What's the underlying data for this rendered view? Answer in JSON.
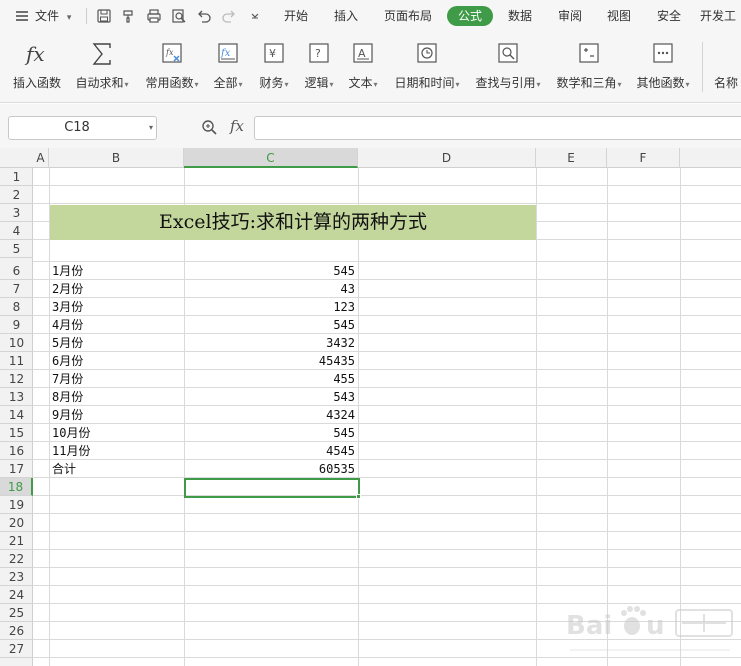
{
  "menubar": {
    "file_label": "文件",
    "tabs": [
      {
        "label": "开始",
        "active": false
      },
      {
        "label": "插入",
        "active": false
      },
      {
        "label": "页面布局",
        "active": false
      },
      {
        "label": "公式",
        "active": true
      },
      {
        "label": "数据",
        "active": false
      },
      {
        "label": "审阅",
        "active": false
      },
      {
        "label": "视图",
        "active": false
      },
      {
        "label": "安全",
        "active": false
      },
      {
        "label": "开发工",
        "active": false
      }
    ],
    "quick_icons": [
      "save-icon",
      "format-painter-icon",
      "print-icon",
      "print-preview-icon",
      "undo-icon",
      "redo-icon",
      "customize-icon"
    ]
  },
  "ribbon": {
    "buttons": [
      {
        "label": "插入函数",
        "icon": "fx-icon"
      },
      {
        "label": "自动求和",
        "icon": "sigma-icon"
      },
      {
        "label": "常用函数",
        "icon": "common-functions-icon"
      },
      {
        "label": "全部",
        "icon": "all-functions-icon"
      },
      {
        "label": "财务",
        "icon": "finance-icon"
      },
      {
        "label": "逻辑",
        "icon": "logic-icon"
      },
      {
        "label": "文本",
        "icon": "text-icon"
      },
      {
        "label": "日期和时间",
        "icon": "clock-icon"
      },
      {
        "label": "查找与引用",
        "icon": "lookup-icon"
      },
      {
        "label": "数学和三角",
        "icon": "math-icon"
      },
      {
        "label": "其他函数",
        "icon": "more-functions-icon"
      },
      {
        "label": "名称",
        "icon": "name-manager-icon"
      }
    ]
  },
  "formula_bar": {
    "name_box": "C18",
    "fx_label": "fx",
    "formula": ""
  },
  "sheet": {
    "columns": [
      "A",
      "B",
      "C",
      "D",
      "E",
      "F"
    ],
    "selected_column": "C",
    "rows": [
      "1",
      "2",
      "3",
      "4",
      "5",
      "6",
      "7",
      "8",
      "9",
      "10",
      "11",
      "12",
      "13",
      "14",
      "15",
      "16",
      "17",
      "18",
      "19",
      "20",
      "21",
      "22",
      "23",
      "24",
      "25",
      "26",
      "27"
    ],
    "selected_row": "18",
    "title": "Excel技巧:求和计算的两种方式",
    "title_fill": "#c3d69b",
    "data": [
      {
        "month": "1月份",
        "value": "545"
      },
      {
        "month": "2月份",
        "value": "43"
      },
      {
        "month": "3月份",
        "value": "123"
      },
      {
        "month": "4月份",
        "value": "545"
      },
      {
        "month": "5月份",
        "value": "3432"
      },
      {
        "month": "6月份",
        "value": "45435"
      },
      {
        "month": "7月份",
        "value": "455"
      },
      {
        "month": "8月份",
        "value": "543"
      },
      {
        "month": "9月份",
        "value": "4324"
      },
      {
        "month": "10月份",
        "value": "545"
      },
      {
        "month": "11月份",
        "value": "4545"
      }
    ],
    "total_label": "合计",
    "total_value": "60535"
  },
  "colors": {
    "accent": "#3f9b48"
  }
}
